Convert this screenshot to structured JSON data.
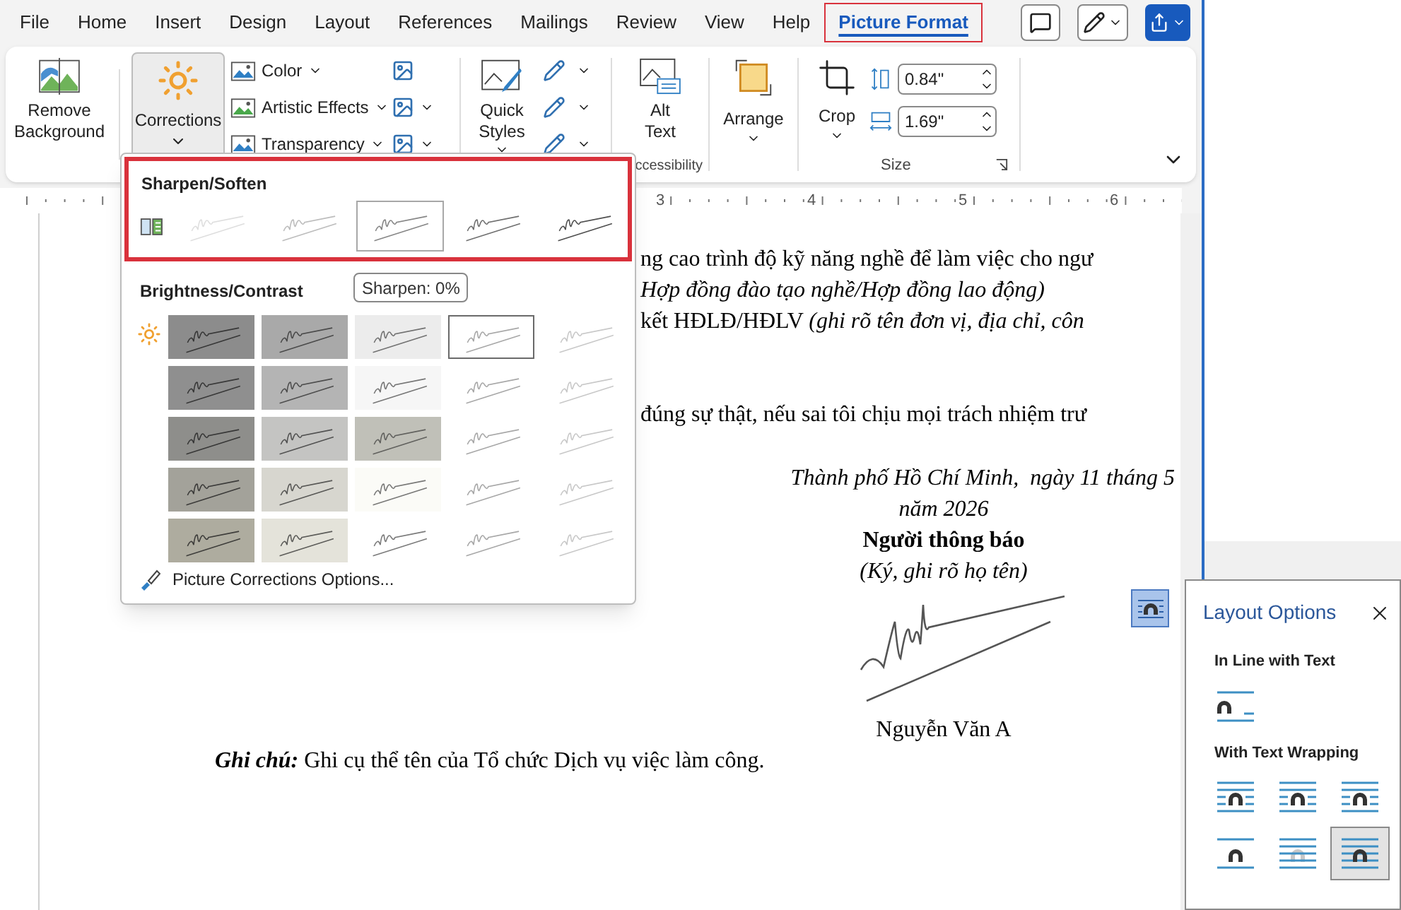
{
  "tabs": [
    {
      "label": "File",
      "selected": false,
      "highlighted": false
    },
    {
      "label": "Home",
      "selected": false,
      "highlighted": false
    },
    {
      "label": "Insert",
      "selected": false,
      "highlighted": false
    },
    {
      "label": "Design",
      "selected": false,
      "highlighted": false
    },
    {
      "label": "Layout",
      "selected": false,
      "highlighted": false
    },
    {
      "label": "References",
      "selected": false,
      "highlighted": false
    },
    {
      "label": "Mailings",
      "selected": false,
      "highlighted": false
    },
    {
      "label": "Review",
      "selected": false,
      "highlighted": false
    },
    {
      "label": "View",
      "selected": false,
      "highlighted": false
    },
    {
      "label": "Help",
      "selected": false,
      "highlighted": false
    },
    {
      "label": "Picture Format",
      "selected": true,
      "highlighted": true
    }
  ],
  "ribbon": {
    "adjust": {
      "remove_background": "Remove Background",
      "corrections": {
        "label": "Corrections",
        "pressed": true
      },
      "small_buttons": [
        "Color",
        "Artistic Effects",
        "Transparency"
      ]
    },
    "picture_styles": {
      "quick_styles": "Quick Styles"
    },
    "accessibility": {
      "alt_text": "Alt Text",
      "group_label": "ccessibility"
    },
    "arrange": {
      "label": "Arrange"
    },
    "size": {
      "crop": "Crop",
      "height": "0.84\"",
      "width": "1.69\"",
      "group_label": "Size"
    }
  },
  "ruler": {
    "numbers": [
      "3",
      "4",
      "5",
      "6"
    ]
  },
  "corrections_menu": {
    "sharpen_soften": {
      "title": "Sharpen/Soften",
      "highlighted": true,
      "presets": [
        {
          "selected": false
        },
        {
          "selected": false
        },
        {
          "selected": true
        },
        {
          "selected": false
        },
        {
          "selected": false
        }
      ]
    },
    "tooltip": "Sharpen: 0%",
    "brightness_contrast": {
      "title": "Brightness/Contrast",
      "rows": [
        {
          "presets": [
            {
              "color": "#8c8c8c",
              "selected": false
            },
            {
              "color": "#a9a9a9",
              "selected": false
            },
            {
              "color": "#ececec",
              "selected": false
            },
            {
              "color": "#ffffff",
              "selected": true
            },
            {
              "color": "#ffffff",
              "selected": false
            }
          ]
        },
        {
          "presets": [
            {
              "color": "#8f8f8f",
              "selected": false
            },
            {
              "color": "#b4b4b4",
              "selected": false
            },
            {
              "color": "#f6f6f6",
              "selected": false
            },
            {
              "color": "#ffffff",
              "selected": false
            },
            {
              "color": "#ffffff",
              "selected": false
            }
          ]
        },
        {
          "presets": [
            {
              "color": "#8e8e8b",
              "selected": false
            },
            {
              "color": "#c4c4c2",
              "selected": false
            },
            {
              "color": "#c0c0b8",
              "selected": false
            },
            {
              "color": "#ffffff",
              "selected": false
            },
            {
              "color": "#ffffff",
              "selected": false
            }
          ]
        },
        {
          "presets": [
            {
              "color": "#a3a29a",
              "selected": false
            },
            {
              "color": "#d7d6cf",
              "selected": false
            },
            {
              "color": "#fbfbf7",
              "selected": false
            },
            {
              "color": "#ffffff",
              "selected": false
            },
            {
              "color": "#ffffff",
              "selected": false
            }
          ]
        },
        {
          "presets": [
            {
              "color": "#aeac9f",
              "selected": false
            },
            {
              "color": "#e4e3da",
              "selected": false
            },
            {
              "color": "#ffffff",
              "selected": false
            },
            {
              "color": "#ffffff",
              "selected": false
            },
            {
              "color": "#ffffff",
              "selected": false
            }
          ]
        }
      ]
    },
    "options_link": "Picture Corrections Options..."
  },
  "document": {
    "lines": [
      "ng cao trình độ kỹ năng nghề để làm việc cho ngư",
      "*Hợp đồng đào tạo nghề/Hợp đồng lao động)*",
      "kết HĐLĐ/HĐLV *(ghi rõ tên đơn vị, địa chỉ, côn*",
      "đúng sự thật, nếu sai tôi chịu mọi trách nhiệm trư"
    ],
    "place_date": "Thành phố Hồ Chí Minh,  ngày 11 tháng 5",
    "year": "năm 2026",
    "signer_title": "Người thông báo",
    "sign_hint": "(Ký, ghi rõ họ tên)",
    "signer_name": "Nguyễn Văn A",
    "note": "**Ghi chú:** Ghi cụ thể tên của Tổ chức Dịch vụ việc làm công."
  },
  "layout_options": {
    "title": "Layout Options",
    "inline_title": "In Line with Text",
    "inline": [
      {
        "kind": "inline",
        "selected": false
      }
    ],
    "wrapping_title": "With Text Wrapping",
    "wrapping": [
      {
        "kind": "square",
        "selected": false
      },
      {
        "kind": "tight",
        "selected": false
      },
      {
        "kind": "through",
        "selected": false
      },
      {
        "kind": "topbottom",
        "selected": false
      },
      {
        "kind": "behind",
        "selected": false
      },
      {
        "kind": "front",
        "selected": true
      }
    ]
  }
}
